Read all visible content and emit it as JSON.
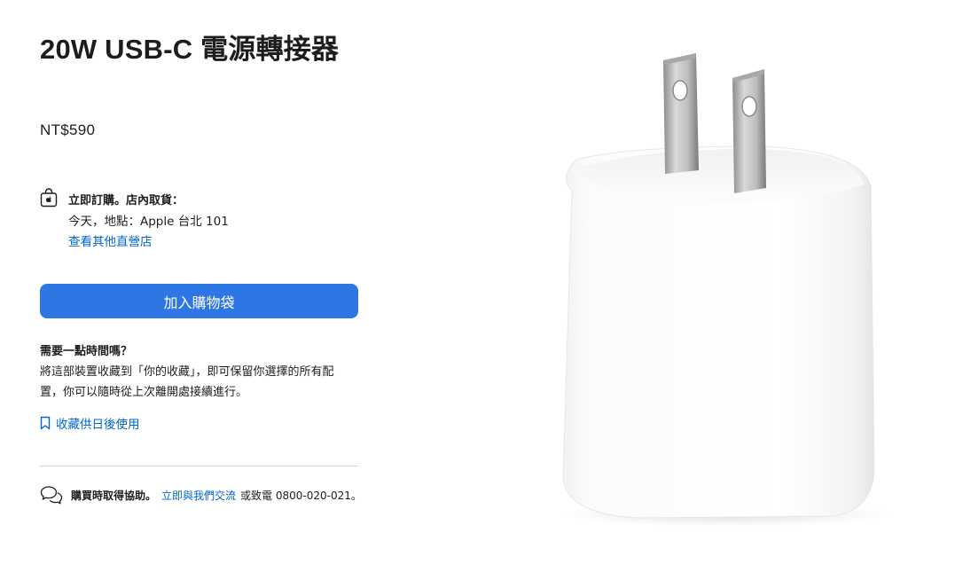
{
  "product": {
    "title": "20W USB-C 電源轉接器",
    "price": "NT$590",
    "image_alt": "20W USB-C 電源轉接器"
  },
  "pickup": {
    "icon": "shopping-bag-icon",
    "title": "立即訂購。店內取貨：",
    "location": "今天，地點：Apple 台北 101",
    "other_stores_link": "查看其他直營店"
  },
  "add_to_bag": {
    "label": "加入購物袋"
  },
  "save": {
    "title": "需要一點時間嗎？",
    "description": "將這部裝置收藏到「你的收藏」，即可保留你選擇的所有配置，你可以隨時從上次離開處接續進行。",
    "link_icon": "bookmark-icon",
    "link_label": "收藏供日後使用"
  },
  "help": {
    "icon": "chat-bubbles-icon",
    "strong": "購買時取得協助。",
    "link": "立即與我們交流",
    "tail": "或致電 0800-020-021。"
  },
  "colors": {
    "accent": "#0066cc",
    "button_bg": "#2d76e4",
    "text": "#1d1d1f",
    "divider": "#d2d2d7"
  }
}
